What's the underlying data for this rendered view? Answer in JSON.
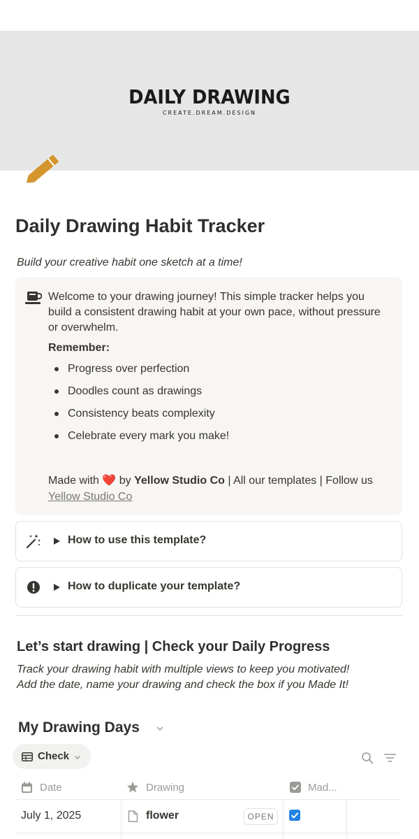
{
  "cover": {
    "title": "DAILY DRAWING",
    "subtitle": "CREATE.DREAM.DESIGN"
  },
  "page": {
    "icon": "pencil-icon",
    "title": "Daily Drawing Habit Tracker",
    "subtitle": "Build your creative habit one sketch at a time!"
  },
  "callout": {
    "icon": "coffee-cup-icon",
    "intro": "Welcome to your drawing journey! This simple tracker helps you build a consistent drawing habit at your own pace, without pressure or overwhelm.",
    "remember_label": "Remember:",
    "bullets": [
      "Progress over perfection",
      "Doodles count as drawings",
      "Consistency beats complexity",
      "Celebrate every mark you make!"
    ],
    "made_with_prefix": "Made with",
    "heart": "❤️",
    "by": "by",
    "studio": "Yellow Studio Co",
    "middle": "| All our templates | Follow us",
    "follow_link": "Yellow Studio Co"
  },
  "toggles": [
    {
      "icon": "magic-wand-icon",
      "label": "How to use this template?"
    },
    {
      "icon": "exclamation-icon",
      "label": "How to duplicate your template?"
    }
  ],
  "section": {
    "title": "Let’s start drawing | Check your Daily Progress",
    "desc_line1": "Track your drawing habit with multiple views to keep you motivated!",
    "desc_line2": "Add the date, name your drawing and check the box if you Made It!"
  },
  "database": {
    "title": "My Drawing Days",
    "view_label": "Check",
    "columns": [
      "Date",
      "Drawing",
      "Mad..."
    ],
    "rows": [
      {
        "date": "July 1, 2025",
        "drawing": "flower",
        "open_label": "OPEN",
        "made_it": true
      }
    ]
  },
  "colors": {
    "cover_bg": "#e6e6e6",
    "pencil": "#d4952c",
    "callout_bg": "#f7f6f3",
    "checkbox": "#2383e2",
    "heart": "#e03e3e"
  }
}
